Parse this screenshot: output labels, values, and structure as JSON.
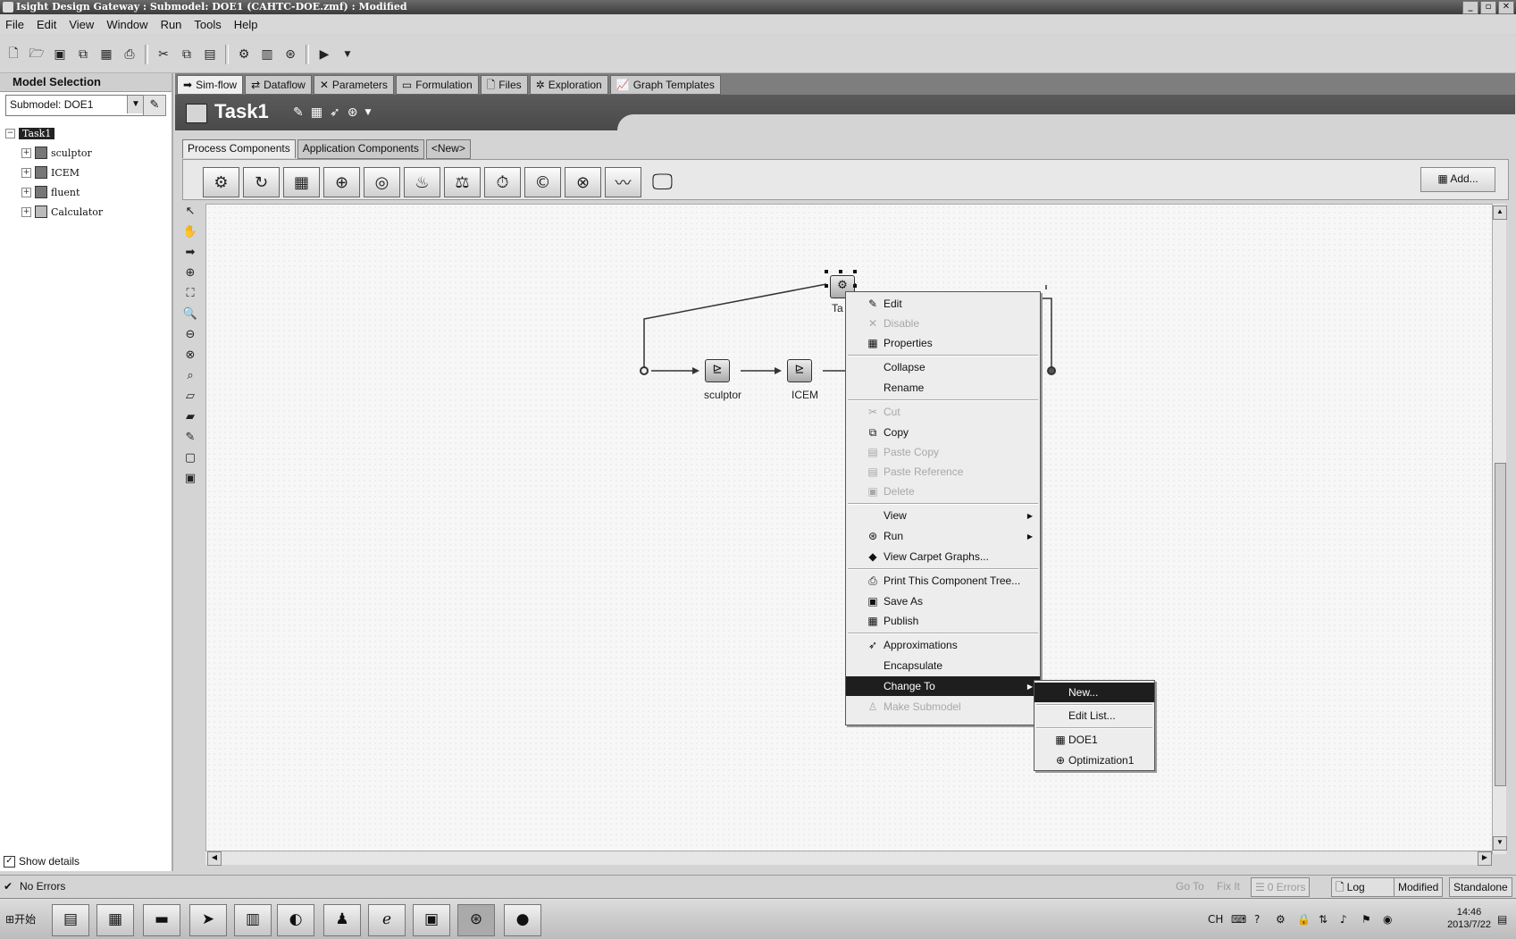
{
  "window": {
    "title": "Isight Design Gateway : Submodel: DOE1 (CAHTC-DOE.zmf)  : Modified"
  },
  "menubar": [
    "File",
    "Edit",
    "View",
    "Window",
    "Run",
    "Tools",
    "Help"
  ],
  "model_selection": {
    "header": "Model Selection",
    "submodel_value": "Submodel: DOE1",
    "tree": [
      {
        "label": "Task1",
        "selected": true
      },
      {
        "label": "sculptor"
      },
      {
        "label": "ICEM"
      },
      {
        "label": "fluent"
      },
      {
        "label": "Calculator"
      }
    ],
    "show_details": "Show details"
  },
  "main_tabs": [
    "Sim-flow",
    "Dataflow",
    "Parameters",
    "Formulation",
    "Files",
    "Exploration",
    "Graph Templates"
  ],
  "task": {
    "title": "Task1"
  },
  "component_tabs": [
    "Process Components",
    "Application Components",
    "<New>"
  ],
  "palette": {
    "add_label": "Add..."
  },
  "graph": {
    "nodes": {
      "task": "Ta",
      "sculptor": "sculptor",
      "icem": "ICEM"
    }
  },
  "context_menu": {
    "items": [
      {
        "label": "Edit",
        "icon": "edit-icon"
      },
      {
        "label": "Disable",
        "icon": "disable-icon",
        "disabled": true
      },
      {
        "label": "Properties",
        "icon": "properties-icon"
      },
      {
        "label": "Collapse"
      },
      {
        "label": "Rename"
      },
      {
        "label": "Cut",
        "icon": "cut-icon",
        "disabled": true
      },
      {
        "label": "Copy",
        "icon": "copy-icon"
      },
      {
        "label": "Paste Copy",
        "icon": "paste-icon",
        "disabled": true
      },
      {
        "label": "Paste Reference",
        "icon": "paste-reference-icon",
        "disabled": true
      },
      {
        "label": "Delete",
        "icon": "delete-icon",
        "disabled": true
      },
      {
        "label": "View",
        "submenu": true
      },
      {
        "label": "Run",
        "icon": "run-icon",
        "submenu": true
      },
      {
        "label": "View Carpet Graphs...",
        "icon": "carpet-graph-icon"
      },
      {
        "label": "Print This Component Tree...",
        "icon": "print-icon"
      },
      {
        "label": "Save As",
        "icon": "save-icon"
      },
      {
        "label": "Publish",
        "icon": "publish-icon"
      },
      {
        "label": "Approximations",
        "icon": "approximations-icon"
      },
      {
        "label": "Encapsulate"
      },
      {
        "label": "Change To",
        "submenu": true,
        "highlighted": true
      },
      {
        "label": "Make Submodel",
        "icon": "submodel-icon",
        "disabled": true
      }
    ]
  },
  "change_to_submenu": {
    "items": [
      {
        "label": "New...",
        "highlighted": true
      },
      {
        "label": "Edit List..."
      },
      {
        "label": "DOE1",
        "icon": "doe-icon"
      },
      {
        "label": "Optimization1",
        "icon": "optimization-icon"
      }
    ]
  },
  "status_bar": {
    "message": "No Errors",
    "goto": "Go To",
    "fixit": "Fix It",
    "errors": "0 Errors",
    "log": "Log",
    "modified": "Modified",
    "mode": "Standalone"
  },
  "taskbar": {
    "start_label": "开始",
    "lang": "CH",
    "clock_time": "14:46",
    "clock_date": "2013/7/22"
  }
}
